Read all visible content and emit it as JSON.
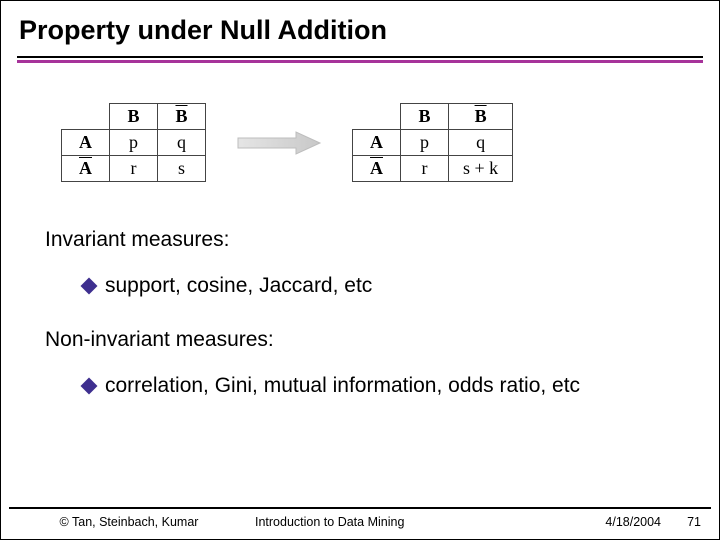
{
  "title": "Property under Null Addition",
  "tables": {
    "left": {
      "col1": "B",
      "col2_bar": "B",
      "row1": "A",
      "row2_bar": "A",
      "c11": "p",
      "c12": "q",
      "c21": "r",
      "c22": "s"
    },
    "right": {
      "col1": "B",
      "col2_bar": "B",
      "row1": "A",
      "row2_bar": "A",
      "c11": "p",
      "c12": "q",
      "c21": "r",
      "c22": "s + k"
    }
  },
  "sections": {
    "invariant_heading": "Invariant measures:",
    "invariant_item": "support, cosine, Jaccard, etc",
    "noninvariant_heading": "Non-invariant measures:",
    "noninvariant_item": "correlation, Gini, mutual information, odds ratio, etc"
  },
  "footer": {
    "copyright": "© Tan, Steinbach, Kumar",
    "course": "Introduction to Data Mining",
    "date": "4/18/2004",
    "page": "71"
  }
}
